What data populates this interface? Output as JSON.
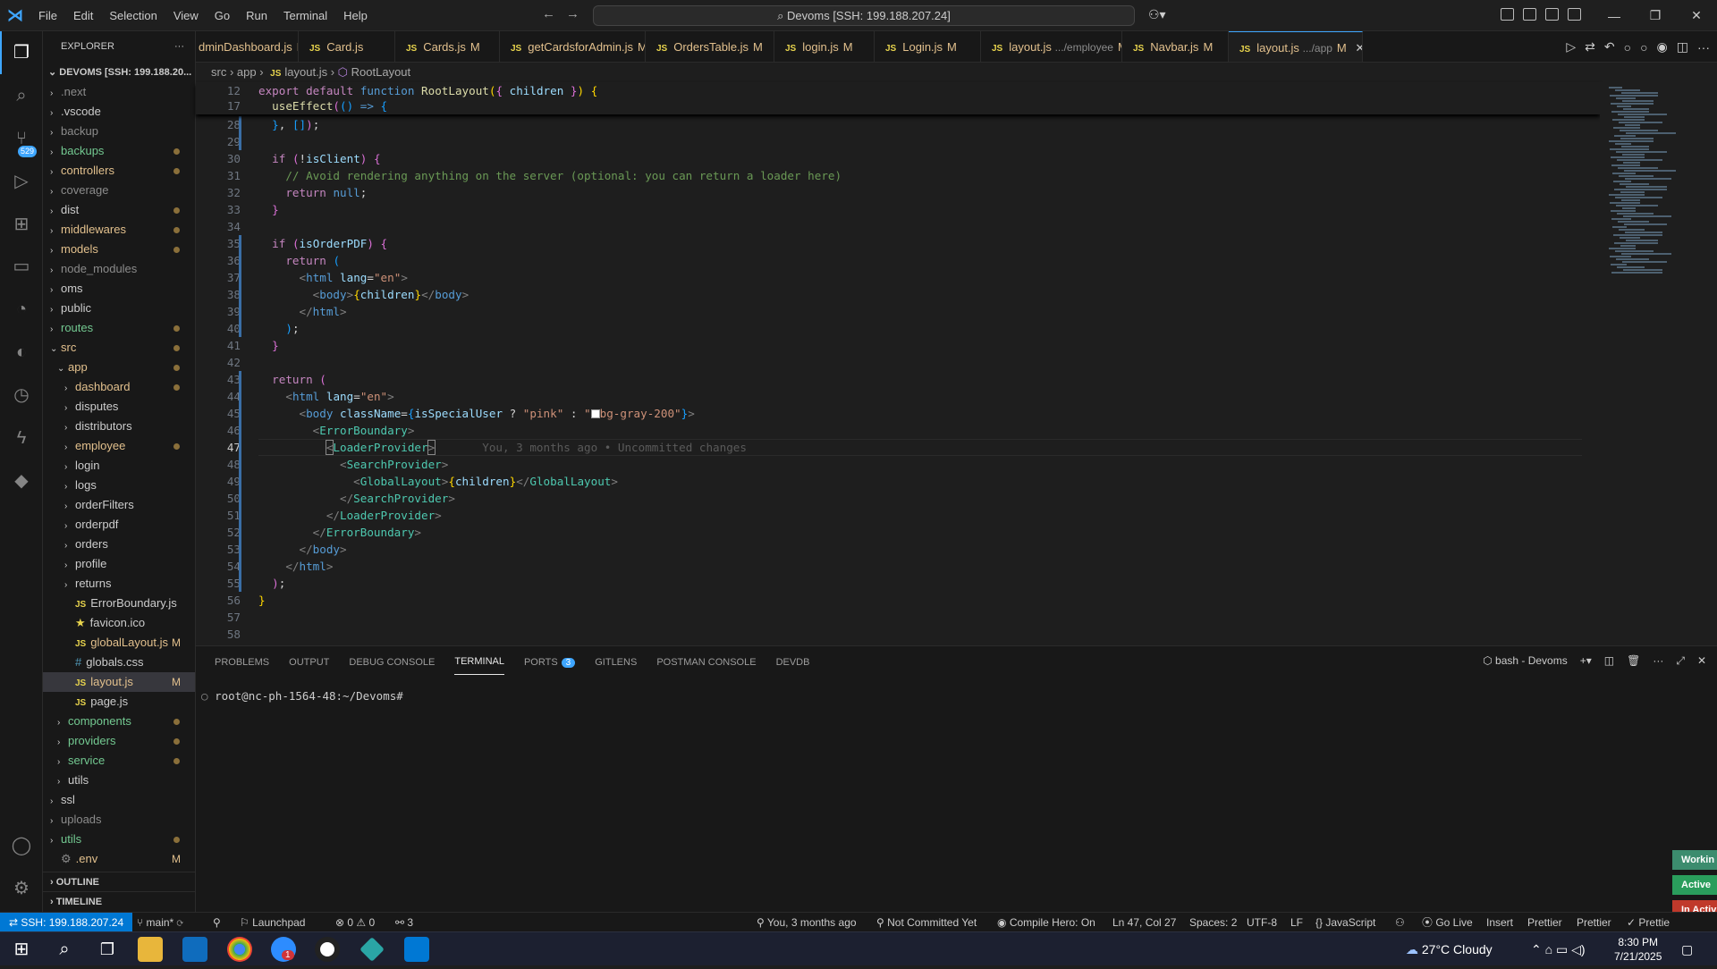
{
  "menu": [
    "File",
    "Edit",
    "Selection",
    "View",
    "Go",
    "Run",
    "Terminal",
    "Help"
  ],
  "command_center": "Devoms [SSH: 199.188.207.24]",
  "explorer": {
    "title": "EXPLORER",
    "root": "DEVOMS [SSH: 199.188.20...",
    "items": [
      {
        "label": ".next",
        "kind": "folder",
        "depth": 0,
        "open": false,
        "marker": "",
        "color": "#8b8b8b"
      },
      {
        "label": ".vscode",
        "kind": "folder",
        "depth": 0,
        "open": false,
        "marker": "",
        "color": "#ccc"
      },
      {
        "label": "backup",
        "kind": "folder",
        "depth": 0,
        "open": false,
        "marker": "",
        "color": "#8b8b8b"
      },
      {
        "label": "backups",
        "kind": "folder",
        "depth": 0,
        "open": false,
        "marker": "dot",
        "color": "#73c991"
      },
      {
        "label": "controllers",
        "kind": "folder",
        "depth": 0,
        "open": false,
        "marker": "dot",
        "color": "#e2c08d"
      },
      {
        "label": "coverage",
        "kind": "folder",
        "depth": 0,
        "open": false,
        "marker": "",
        "color": "#8b8b8b"
      },
      {
        "label": "dist",
        "kind": "folder",
        "depth": 0,
        "open": false,
        "marker": "dot",
        "color": "#ccc"
      },
      {
        "label": "middlewares",
        "kind": "folder",
        "depth": 0,
        "open": false,
        "marker": "dot",
        "color": "#e2c08d"
      },
      {
        "label": "models",
        "kind": "folder",
        "depth": 0,
        "open": false,
        "marker": "dot",
        "color": "#e2c08d"
      },
      {
        "label": "node_modules",
        "kind": "folder",
        "depth": 0,
        "open": false,
        "marker": "",
        "color": "#8b8b8b"
      },
      {
        "label": "oms",
        "kind": "folder",
        "depth": 0,
        "open": false,
        "marker": "",
        "color": "#ccc"
      },
      {
        "label": "public",
        "kind": "folder",
        "depth": 0,
        "open": false,
        "marker": "",
        "color": "#ccc"
      },
      {
        "label": "routes",
        "kind": "folder",
        "depth": 0,
        "open": false,
        "marker": "dot",
        "color": "#73c991"
      },
      {
        "label": "src",
        "kind": "folder",
        "depth": 0,
        "open": true,
        "marker": "dot",
        "color": "#e2c08d"
      },
      {
        "label": "app",
        "kind": "folder",
        "depth": 1,
        "open": true,
        "marker": "dot",
        "color": "#e2c08d"
      },
      {
        "label": "dashboard",
        "kind": "folder",
        "depth": 2,
        "open": false,
        "marker": "dot",
        "color": "#e2c08d"
      },
      {
        "label": "disputes",
        "kind": "folder",
        "depth": 2,
        "open": false,
        "marker": "",
        "color": "#ccc"
      },
      {
        "label": "distributors",
        "kind": "folder",
        "depth": 2,
        "open": false,
        "marker": "",
        "color": "#ccc"
      },
      {
        "label": "employee",
        "kind": "folder",
        "depth": 2,
        "open": false,
        "marker": "dot",
        "color": "#e2c08d"
      },
      {
        "label": "login",
        "kind": "folder",
        "depth": 2,
        "open": false,
        "marker": "",
        "color": "#ccc"
      },
      {
        "label": "logs",
        "kind": "folder",
        "depth": 2,
        "open": false,
        "marker": "",
        "color": "#ccc"
      },
      {
        "label": "orderFilters",
        "kind": "folder",
        "depth": 2,
        "open": false,
        "marker": "",
        "color": "#ccc"
      },
      {
        "label": "orderpdf",
        "kind": "folder",
        "depth": 2,
        "open": false,
        "marker": "",
        "color": "#ccc"
      },
      {
        "label": "orders",
        "kind": "folder",
        "depth": 2,
        "open": false,
        "marker": "",
        "color": "#ccc"
      },
      {
        "label": "profile",
        "kind": "folder",
        "depth": 2,
        "open": false,
        "marker": "",
        "color": "#ccc"
      },
      {
        "label": "returns",
        "kind": "folder",
        "depth": 2,
        "open": false,
        "marker": "",
        "color": "#ccc"
      },
      {
        "label": "ErrorBoundary.js",
        "kind": "js",
        "depth": 2,
        "open": false,
        "marker": "",
        "color": "#ccc"
      },
      {
        "label": "favicon.ico",
        "kind": "star",
        "depth": 2,
        "open": false,
        "marker": "",
        "color": "#ccc"
      },
      {
        "label": "globalLayout.js",
        "kind": "js",
        "depth": 2,
        "open": false,
        "marker": "M",
        "color": "#e2c08d"
      },
      {
        "label": "globals.css",
        "kind": "css",
        "depth": 2,
        "open": false,
        "marker": "",
        "color": "#ccc"
      },
      {
        "label": "layout.js",
        "kind": "js",
        "depth": 2,
        "open": false,
        "marker": "M",
        "color": "#e2c08d",
        "selected": true
      },
      {
        "label": "page.js",
        "kind": "js",
        "depth": 2,
        "open": false,
        "marker": "",
        "color": "#ccc"
      },
      {
        "label": "components",
        "kind": "folder",
        "depth": 1,
        "open": false,
        "marker": "dot",
        "color": "#73c991"
      },
      {
        "label": "providers",
        "kind": "folder",
        "depth": 1,
        "open": false,
        "marker": "dot",
        "color": "#73c991"
      },
      {
        "label": "service",
        "kind": "folder",
        "depth": 1,
        "open": false,
        "marker": "dot",
        "color": "#73c991"
      },
      {
        "label": "utils",
        "kind": "folder",
        "depth": 1,
        "open": false,
        "marker": "",
        "color": "#ccc"
      },
      {
        "label": "ssl",
        "kind": "folder",
        "depth": 0,
        "open": false,
        "marker": "",
        "color": "#ccc"
      },
      {
        "label": "uploads",
        "kind": "folder",
        "depth": 0,
        "open": false,
        "marker": "",
        "color": "#8b8b8b"
      },
      {
        "label": "utils",
        "kind": "folder",
        "depth": 0,
        "open": false,
        "marker": "dot",
        "color": "#73c991"
      },
      {
        "label": ".env",
        "kind": "gear",
        "depth": 0,
        "open": false,
        "marker": "M",
        "color": "#e2c08d"
      }
    ],
    "outline": "OUTLINE",
    "timeline": "TIMELINE"
  },
  "tabs": [
    {
      "name": "dminDashboard.js",
      "mod": "M",
      "js": false
    },
    {
      "name": "Card.js",
      "mod": "",
      "js": true
    },
    {
      "name": "Cards.js",
      "mod": "M",
      "js": true
    },
    {
      "name": "getCardsforAdmin.js",
      "mod": "M",
      "js": true
    },
    {
      "name": "OrdersTable.js",
      "mod": "M",
      "js": true
    },
    {
      "name": "login.js",
      "mod": "M",
      "js": true
    },
    {
      "name": "Login.js",
      "mod": "M",
      "js": true
    },
    {
      "name": "layout.js",
      "desc": ".../employee",
      "mod": "M",
      "js": true
    },
    {
      "name": "Navbar.js",
      "mod": "M",
      "js": true
    },
    {
      "name": "layout.js",
      "desc": ".../app",
      "mod": "M",
      "js": true,
      "active": true
    }
  ],
  "breadcrumb": {
    "p1": "src",
    "p2": "app",
    "file": "layout.js",
    "symbol": "RootLayout"
  },
  "sticky": [
    {
      "n": "12",
      "html": "<span class='kc'>export</span> <span class='kc'>default</span> <span class='kw'>function</span> <span class='fn'>RootLayout</span><span class='br'>(</span><span class='pu'>{</span> <span class='va'>children</span> <span class='pu'>}</span><span class='br'>)</span> <span class='br'>{</span>"
    },
    {
      "n": "17",
      "html": "  <span class='fn'>useEffect</span><span class='pu'>(</span><span class='bl'>()</span> <span class='kw'>=&gt;</span> <span class='bl'>{</span>"
    }
  ],
  "code": [
    {
      "n": "28",
      "html": "  <span class='bl'>}</span>, <span class='bl'>[]</span><span class='pu'>)</span>;"
    },
    {
      "n": "29",
      "html": ""
    },
    {
      "n": "30",
      "html": "  <span class='kc'>if</span> <span class='pu'>(</span>!<span class='va'>isClient</span><span class='pu'>)</span> <span class='pu'>{</span>"
    },
    {
      "n": "31",
      "html": "    <span class='cm'>// Avoid rendering anything on the server (optional: you can return a loader here)</span>"
    },
    {
      "n": "32",
      "html": "    <span class='kc'>return</span> <span class='kw'>null</span>;"
    },
    {
      "n": "33",
      "html": "  <span class='pu'>}</span>"
    },
    {
      "n": "34",
      "html": ""
    },
    {
      "n": "35",
      "html": "  <span class='kc'>if</span> <span class='pu'>(</span><span class='va'>isOrderPDF</span><span class='pu'>)</span> <span class='pu'>{</span>"
    },
    {
      "n": "36",
      "html": "    <span class='kc'>return</span> <span class='bl'>(</span>"
    },
    {
      "n": "37",
      "html": "      <span class='gy'>&lt;</span><span class='kw'>html</span> <span class='va'>lang</span>=<span class='st'>\"en\"</span><span class='gy'>&gt;</span>"
    },
    {
      "n": "38",
      "html": "        <span class='gy'>&lt;</span><span class='kw'>body</span><span class='gy'>&gt;</span><span class='br'>{</span><span class='va'>children</span><span class='br'>}</span><span class='gy'>&lt;/</span><span class='kw'>body</span><span class='gy'>&gt;</span>"
    },
    {
      "n": "39",
      "html": "      <span class='gy'>&lt;/</span><span class='kw'>html</span><span class='gy'>&gt;</span>"
    },
    {
      "n": "40",
      "html": "    <span class='bl'>)</span>;"
    },
    {
      "n": "41",
      "html": "  <span class='pu'>}</span>"
    },
    {
      "n": "42",
      "html": ""
    },
    {
      "n": "43",
      "html": "  <span class='kc'>return</span> <span class='pu'>(</span>"
    },
    {
      "n": "44",
      "html": "    <span class='gy'>&lt;</span><span class='kw'>html</span> <span class='va'>lang</span>=<span class='st'>\"en\"</span><span class='gy'>&gt;</span>"
    },
    {
      "n": "45",
      "html": "      <span class='gy'>&lt;</span><span class='kw'>body</span> <span class='va'>className</span>=<span class='bl'>{</span><span class='va'>isSpecialUser</span> ? <span class='st'>\"pink\"</span> : <span class='st'>\"</span><span style='display:inline-block;width:10px;height:10px;background:#fff;border:1px solid #999;vertical-align:-1px'></span><span class='st'>bg-gray-200\"</span><span class='bl'>}</span><span class='gy'>&gt;</span>"
    },
    {
      "n": "46",
      "html": "        <span class='gy'>&lt;</span><span class='tg'>ErrorBoundary</span><span class='gy'>&gt;</span>"
    },
    {
      "n": "47",
      "html": "          <span class='gy' style='outline:1px solid #888'>&lt;</span><span class='tg'>LoaderProvider</span><span class='gy' style='outline:1px solid #888'>&gt;</span>       <span style='color:#5a5a5a'>You, 3 months ago • Uncommitted changes</span>",
      "cur": true
    },
    {
      "n": "48",
      "html": "            <span class='gy'>&lt;</span><span class='tg'>SearchProvider</span><span class='gy'>&gt;</span>"
    },
    {
      "n": "49",
      "html": "              <span class='gy'>&lt;</span><span class='tg'>GlobalLayout</span><span class='gy'>&gt;</span><span class='br'>{</span><span class='va'>children</span><span class='br'>}</span><span class='gy'>&lt;/</span><span class='tg'>GlobalLayout</span><span class='gy'>&gt;</span>"
    },
    {
      "n": "50",
      "html": "            <span class='gy'>&lt;/</span><span class='tg'>SearchProvider</span><span class='gy'>&gt;</span>"
    },
    {
      "n": "51",
      "html": "          <span class='gy'>&lt;/</span><span class='tg'>LoaderProvider</span><span class='gy'>&gt;</span>"
    },
    {
      "n": "52",
      "html": "        <span class='gy'>&lt;/</span><span class='tg'>ErrorBoundary</span><span class='gy'>&gt;</span>"
    },
    {
      "n": "53",
      "html": "      <span class='gy'>&lt;/</span><span class='kw'>body</span><span class='gy'>&gt;</span>"
    },
    {
      "n": "54",
      "html": "    <span class='gy'>&lt;/</span><span class='kw'>html</span><span class='gy'>&gt;</span>"
    },
    {
      "n": "55",
      "html": "  <span class='pu'>)</span>;"
    },
    {
      "n": "56",
      "html": "<span class='br'>}</span>"
    },
    {
      "n": "57",
      "html": ""
    },
    {
      "n": "58",
      "html": ""
    }
  ],
  "panel": {
    "tabs": [
      "PROBLEMS",
      "OUTPUT",
      "DEBUG CONSOLE",
      "TERMINAL",
      "PORTS",
      "GITLENS",
      "POSTMAN CONSOLE",
      "DEVDB"
    ],
    "active_tab": "TERMINAL",
    "ports_badge": "3",
    "shell": "bash - Devoms",
    "prompt": "root@nc-ph-1564-48:~/Devoms#",
    "side_buttons": [
      "Workin",
      "Active",
      "In Activ"
    ]
  },
  "status": {
    "remote": "SSH: 199.188.207.24",
    "branch": "main*",
    "launchpad": "Launchpad",
    "errors": "0",
    "warnings": "0",
    "ports": "3",
    "blame": "You, 3 months ago",
    "commit": "Not Committed Yet",
    "compile": "Compile Hero: On",
    "position": "Ln 47, Col 27",
    "spaces": "Spaces: 2",
    "encoding": "UTF-8",
    "eol": "LF",
    "language": "JavaScript",
    "golive": "Go Live",
    "mode": "Insert",
    "prettier1": "Prettier",
    "prettier2": "Prettier",
    "prettier3": "Prettie"
  },
  "activity_badge": "529",
  "taskbar": {
    "weather": "27°C  Cloudy",
    "time": "8:30 PM",
    "date": "7/21/2025",
    "zoom_badge": "1"
  },
  "colors": {
    "accent": "#3ea6ff",
    "modified": "#e2c08d",
    "untracked": "#73c991"
  }
}
